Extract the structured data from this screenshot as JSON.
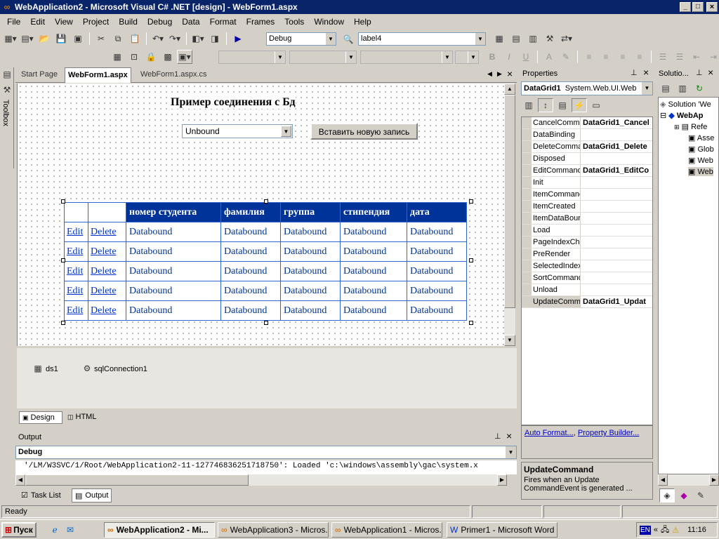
{
  "window": {
    "title": "WebApplication2 - Microsoft Visual C# .NET [design] - WebForm1.aspx",
    "controls": [
      "_",
      "□",
      "×"
    ]
  },
  "menu": [
    "File",
    "Edit",
    "View",
    "Project",
    "Build",
    "Debug",
    "Data",
    "Format",
    "Frames",
    "Tools",
    "Window",
    "Help"
  ],
  "toolbar": {
    "config": "Debug",
    "find": "label4"
  },
  "left_dock": {
    "toolbox_label": "Toolbox"
  },
  "doc_tabs": [
    "Start Page",
    "WebForm1.aspx",
    "WebForm1.aspx.cs"
  ],
  "design": {
    "heading": "Пример соединения с Бд",
    "dropdown_value": "Unbound",
    "insert_button": "Вставить новую запись",
    "grid_headers": [
      "номер студента",
      "фамилия",
      "группа",
      "стипендия",
      "дата"
    ],
    "edit_link": "Edit",
    "delete_link": "Delete",
    "cell": "Databound",
    "rows": 5
  },
  "components": [
    "ds1",
    "sqlConnection1"
  ],
  "view_tabs": [
    "Design",
    "HTML"
  ],
  "output": {
    "title": "Output",
    "source": "Debug",
    "line": "'/LM/W3SVC/1/Root/WebApplication2-11-127746836251718750': Loaded 'c:\\windows\\assembly\\gac\\system.x"
  },
  "bottom_tabs": [
    "Task List",
    "Output"
  ],
  "properties": {
    "title": "Properties",
    "object": "DataGrid1",
    "object_type": "System.Web.UI.Web",
    "rows": [
      {
        "name": "CancelComma",
        "value": "DataGrid1_Cancel"
      },
      {
        "name": "DataBinding",
        "value": ""
      },
      {
        "name": "DeleteComma",
        "value": "DataGrid1_Delete"
      },
      {
        "name": "Disposed",
        "value": ""
      },
      {
        "name": "EditCommand",
        "value": "DataGrid1_EditCo"
      },
      {
        "name": "Init",
        "value": ""
      },
      {
        "name": "ItemCommanc",
        "value": ""
      },
      {
        "name": "ItemCreated",
        "value": ""
      },
      {
        "name": "ItemDataBour",
        "value": ""
      },
      {
        "name": "Load",
        "value": ""
      },
      {
        "name": "PageIndexCha",
        "value": ""
      },
      {
        "name": "PreRender",
        "value": ""
      },
      {
        "name": "SelectedIndex",
        "value": ""
      },
      {
        "name": "SortCommand",
        "value": ""
      },
      {
        "name": "Unload",
        "value": ""
      },
      {
        "name": "UpdateComma",
        "value": "DataGrid1_Updat"
      }
    ],
    "link1": "Auto Format...",
    "link2": "Property Builder...",
    "desc_title": "UpdateCommand",
    "desc_text": "Fires when an Update CommandEvent is generated ..."
  },
  "solution": {
    "title": "Solutio...",
    "items": [
      "Solution 'We",
      "WebAp",
      "Refe",
      "Asse",
      "Glob",
      "Web",
      "Web"
    ]
  },
  "status": "Ready",
  "taskbar": {
    "start": "Пуск",
    "tasks": [
      "WebApplication2 - Mi...",
      "WebApplication3 - Micros...",
      "WebApplication1 - Micros...",
      "Primer1 - Microsoft Word"
    ],
    "lang": "EN",
    "clock": "11:16"
  }
}
